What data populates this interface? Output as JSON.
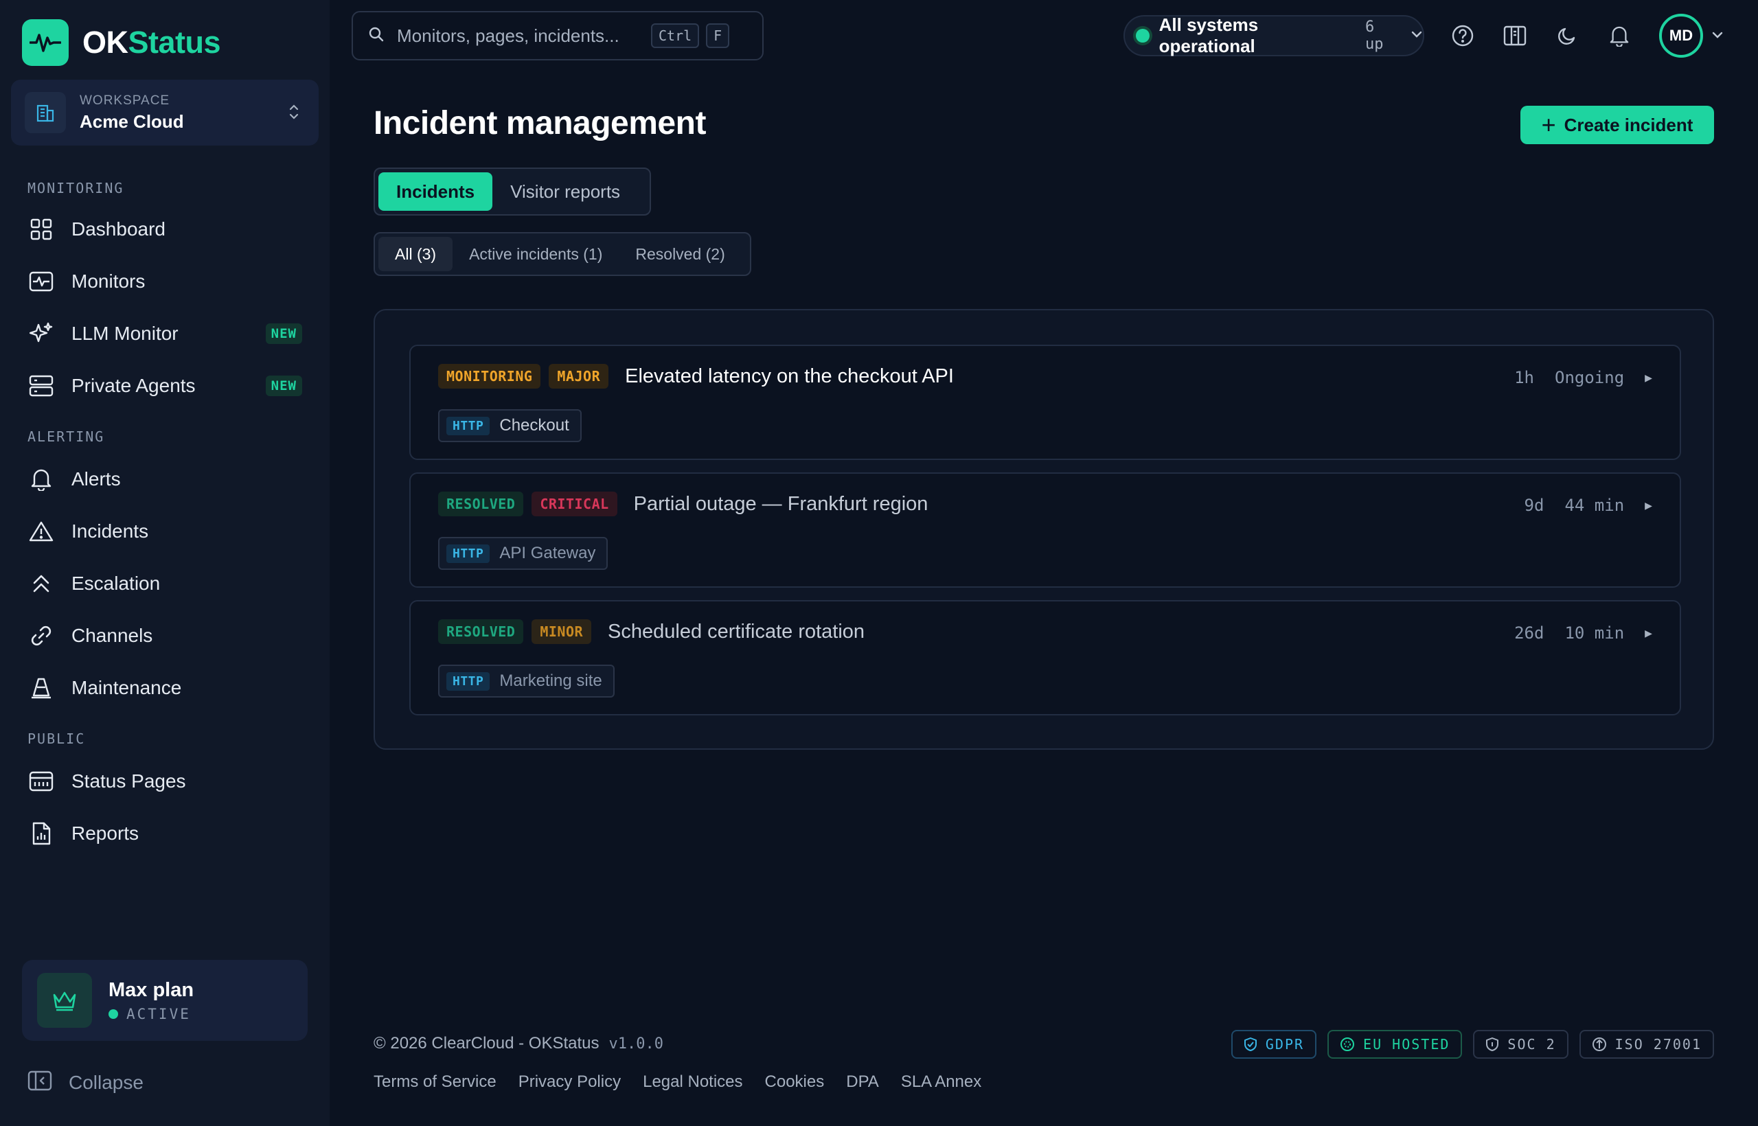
{
  "brand": {
    "name_a": "OK",
    "name_b": "Status"
  },
  "workspace": {
    "label": "WORKSPACE",
    "name": "Acme Cloud"
  },
  "sidebar": {
    "sections": [
      "MONITORING",
      "ALERTING",
      "PUBLIC"
    ],
    "items": [
      {
        "label": "Dashboard",
        "icon": "grid-icon"
      },
      {
        "label": "Monitors",
        "icon": "pulse-icon"
      },
      {
        "label": "LLM Monitor",
        "icon": "sparkle-icon",
        "badge": "NEW"
      },
      {
        "label": "Private Agents",
        "icon": "server-icon",
        "badge": "NEW"
      },
      {
        "label": "Alerts",
        "icon": "bell-icon"
      },
      {
        "label": "Incidents",
        "icon": "warning-icon"
      },
      {
        "label": "Escalation",
        "icon": "chevrons-up-icon"
      },
      {
        "label": "Channels",
        "icon": "link-icon"
      },
      {
        "label": "Maintenance",
        "icon": "cone-icon"
      },
      {
        "label": "Status Pages",
        "icon": "calendar-icon"
      },
      {
        "label": "Reports",
        "icon": "report-icon"
      }
    ],
    "plan": {
      "name": "Max plan",
      "status": "ACTIVE"
    },
    "collapse": "Collapse"
  },
  "topbar": {
    "search_placeholder": "Monitors, pages, incidents...",
    "shortcut": [
      "Ctrl",
      "F"
    ],
    "status_text": "All systems operational",
    "status_count": "6 up",
    "avatar": "MD"
  },
  "main": {
    "title": "Incident management",
    "create_label": "Create incident",
    "tabs": [
      "Incidents",
      "Visitor reports"
    ],
    "filters": [
      "All (3)",
      "Active incidents (1)",
      "Resolved (2)"
    ],
    "incidents": [
      {
        "state": "MONITORING",
        "severity": "MAJOR",
        "title": "Elevated latency on the checkout API",
        "age": "1h",
        "duration": "Ongoing",
        "protocol": "HTTP",
        "monitor": "Checkout"
      },
      {
        "state": "RESOLVED",
        "severity": "CRITICAL",
        "title": "Partial outage — Frankfurt region",
        "age": "9d",
        "duration": "44 min",
        "protocol": "HTTP",
        "monitor": "API Gateway"
      },
      {
        "state": "RESOLVED",
        "severity": "MINOR",
        "title": "Scheduled certificate rotation",
        "age": "26d",
        "duration": "10 min",
        "protocol": "HTTP",
        "monitor": "Marketing site"
      }
    ]
  },
  "footer": {
    "copyright": "© 2026 ClearCloud - OKStatus",
    "version": "v1.0.0",
    "links": [
      "Terms of Service",
      "Privacy Policy",
      "Legal Notices",
      "Cookies",
      "DPA",
      "SLA Annex"
    ],
    "badges": [
      "GDPR",
      "EU HOSTED",
      "SOC 2",
      "ISO 27001"
    ]
  },
  "colors": {
    "accent": "#1ed4a0",
    "background": "#0b1220",
    "sidebar": "#101828",
    "major": "#f0a52a",
    "critical": "#d8375a"
  }
}
